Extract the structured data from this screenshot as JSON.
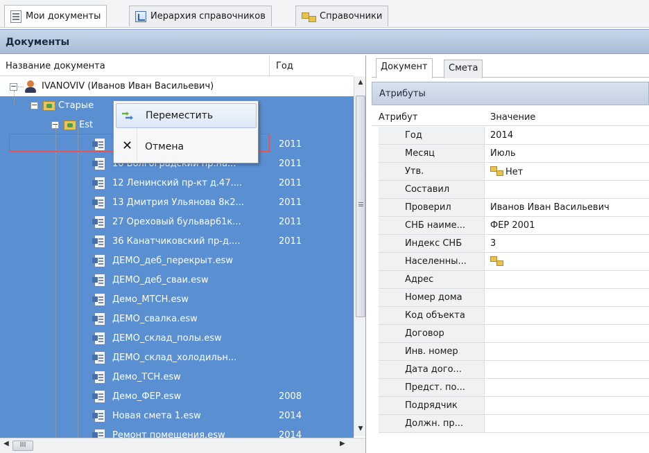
{
  "top_tabs": [
    {
      "label": "Мои документы",
      "icon": "document-icon"
    },
    {
      "label": "Иерархия справочников",
      "icon": "tree-icon"
    },
    {
      "label": "Справочники",
      "icon": "directory-icon"
    }
  ],
  "documents_header": "Документы",
  "tree": {
    "columns": {
      "name": "Название документа",
      "year": "Год"
    },
    "user_node": "IVANOVIV (Иванов Иван Васильевич)",
    "folder_old": "Старые",
    "folder_est": "Est",
    "files": [
      {
        "name": "10 Волгоградский пр.на...",
        "year": "2011"
      },
      {
        "name": "12 Ленинский пр-кт д.47....",
        "year": "2011"
      },
      {
        "name": "13 Дмитрия Ульянова 8к2...",
        "year": "2011"
      },
      {
        "name": "27 Ореховый бульвар61к...",
        "year": "2011"
      },
      {
        "name": "36 Канатчиковский пр-д....",
        "year": "2011"
      },
      {
        "name": "ДЕМО_деб_перекрыт.esw",
        "year": ""
      },
      {
        "name": "ДЕМО_деб_сваи.esw",
        "year": ""
      },
      {
        "name": "Демо_МТСН.esw",
        "year": ""
      },
      {
        "name": "ДЕМО_свалка.esw",
        "year": ""
      },
      {
        "name": "ДЕМО_склад_полы.esw",
        "year": ""
      },
      {
        "name": "ДЕМО_склад_холодильн...",
        "year": ""
      },
      {
        "name": "Демо_ТСН.esw",
        "year": ""
      },
      {
        "name": "Демо_ФЕР.esw",
        "year": "2008"
      },
      {
        "name": "Новая смета 1.esw",
        "year": "2014"
      },
      {
        "name": "Ремонт помещения.esw",
        "year": "2014"
      }
    ],
    "first_row_year": "2011",
    "hscroll_thumb": "III"
  },
  "context_menu": {
    "move": "Переместить",
    "cancel": "Отмена"
  },
  "right_tabs": [
    "Документ",
    "Смета"
  ],
  "attributes": {
    "header": "Атрибуты",
    "col_attr": "Атрибут",
    "col_value": "Значение",
    "rows": [
      {
        "name": "Год",
        "value": "2014"
      },
      {
        "name": "Месяц",
        "value": "Июль"
      },
      {
        "name": "Утв.",
        "value": "Нет"
      },
      {
        "name": "Составил",
        "value": ""
      },
      {
        "name": "Проверил",
        "value": "Иванов Иван Васильевич"
      },
      {
        "name": "СНБ наиме...",
        "value": "ФЕР 2001"
      },
      {
        "name": "Индекс СНБ",
        "value": "3"
      },
      {
        "name": "Населенны...",
        "value": ""
      },
      {
        "name": "Адрес",
        "value": ""
      },
      {
        "name": "Номер дома",
        "value": ""
      },
      {
        "name": "Код объекта",
        "value": ""
      },
      {
        "name": "Договор",
        "value": ""
      },
      {
        "name": "Инв. номер",
        "value": ""
      },
      {
        "name": "Дата дого...",
        "value": ""
      },
      {
        "name": "Предст. по...",
        "value": ""
      },
      {
        "name": "Подрядчик",
        "value": ""
      },
      {
        "name": "Должн. пр...",
        "value": ""
      }
    ]
  },
  "colors": {
    "selection": "#5a8fd1",
    "header_blue": "#a9bcd6"
  }
}
